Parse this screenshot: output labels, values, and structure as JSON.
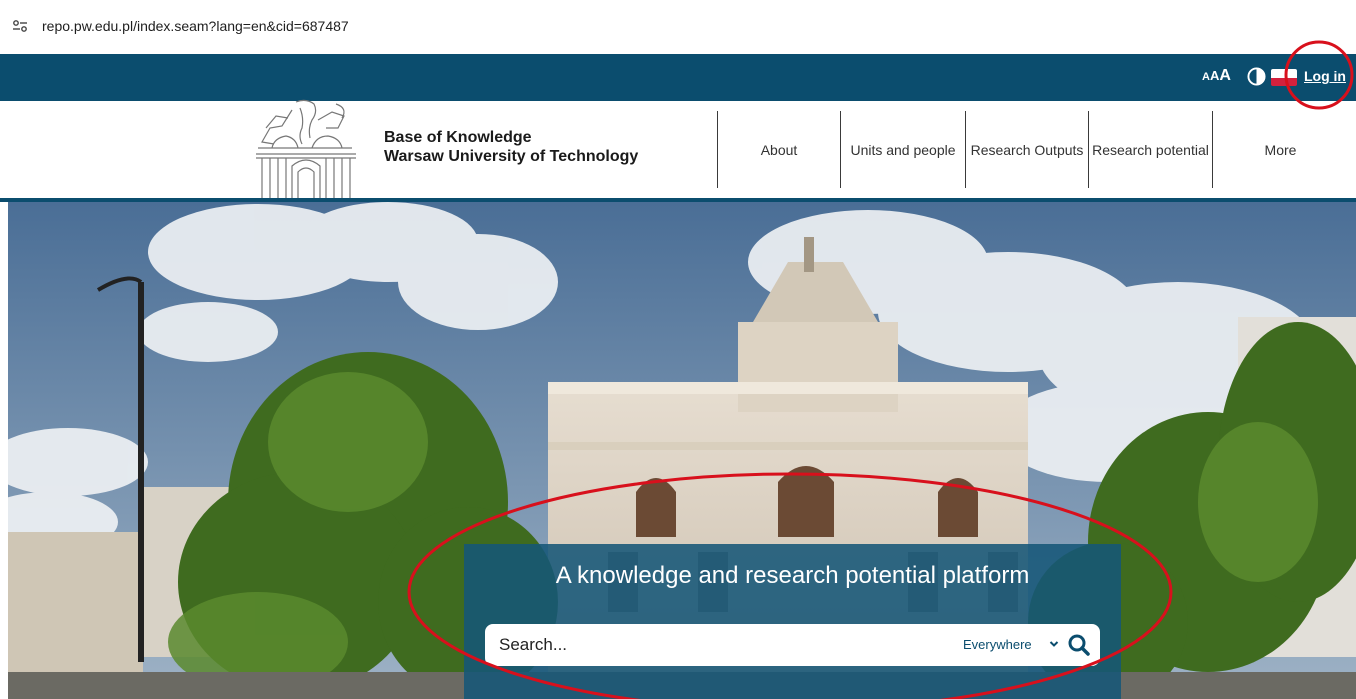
{
  "browser": {
    "url": "repo.pw.edu.pl/index.seam?lang=en&cid=687487"
  },
  "topbar": {
    "font_size_small": "A",
    "font_size_medium": "A",
    "font_size_large": "A",
    "login_label": "Log in"
  },
  "header": {
    "title_line1": "Base of Knowledge",
    "title_line2": "Warsaw University of Technology",
    "nav": {
      "about": "About",
      "units": "Units and people",
      "outputs": "Research Outputs",
      "potential": "Research potential",
      "more": "More"
    }
  },
  "hero": {
    "title": "A knowledge and research potential platform",
    "search_placeholder": "Search...",
    "search_scope": "Everywhere"
  },
  "colors": {
    "brand_dark_blue": "#0b4d6e",
    "panel_blue": "#165678",
    "flag_red": "#d4213d",
    "annotation_red": "#d8101c"
  }
}
